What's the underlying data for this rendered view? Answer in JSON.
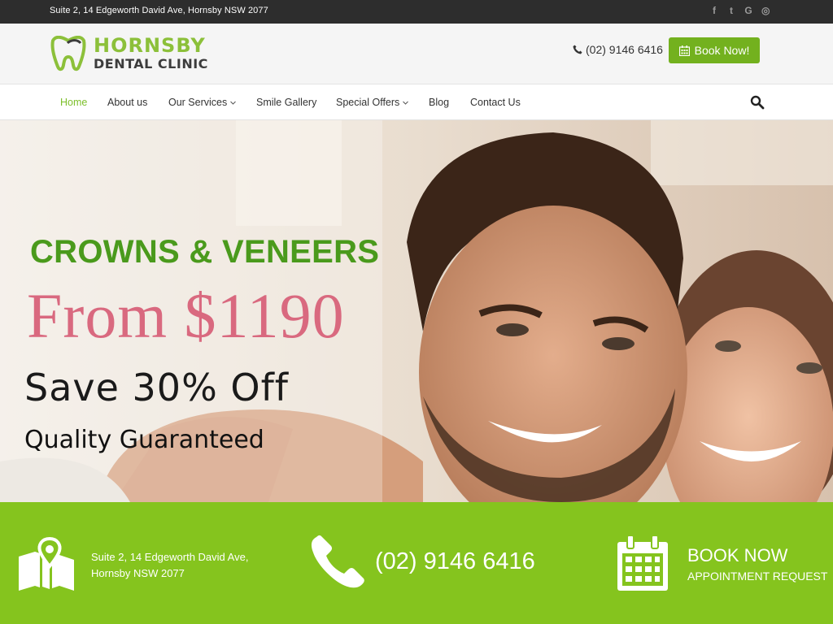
{
  "topbar": {
    "address": "Suite 2, 14 Edgeworth David Ave, Hornsby NSW 2077",
    "social": [
      {
        "icon": "facebook-icon",
        "glyph": "f"
      },
      {
        "icon": "twitter-icon",
        "glyph": "t"
      },
      {
        "icon": "google-icon",
        "glyph": "G"
      },
      {
        "icon": "instagram-icon",
        "glyph": "◎"
      }
    ]
  },
  "header": {
    "logo_line1": "HORNSBY",
    "logo_line2": "DENTAL CLINIC",
    "phone": "(02) 9146 6416",
    "book_label": "Book Now!"
  },
  "nav": {
    "items": [
      {
        "label": "Home",
        "active": true,
        "dropdown": false
      },
      {
        "label": "About us",
        "active": false,
        "dropdown": false
      },
      {
        "label": "Our Services",
        "active": false,
        "dropdown": true
      },
      {
        "label": "Smile Gallery",
        "active": false,
        "dropdown": false
      },
      {
        "label": "Special Offers",
        "active": false,
        "dropdown": true
      },
      {
        "label": "Blog",
        "active": false,
        "dropdown": false
      },
      {
        "label": "Contact Us",
        "active": false,
        "dropdown": false
      }
    ]
  },
  "hero": {
    "title": "CROWNS & VENEERS",
    "price": "From $1190",
    "save": "Save 30% Off",
    "quality": "Quality Guaranteed"
  },
  "strip": {
    "address_line1": "Suite 2, 14 Edgeworth David Ave,",
    "address_line2": "Hornsby NSW 2077",
    "phone": "(02) 9146 6416",
    "book_title": "BOOK NOW",
    "book_sub": "APPOINTMENT REQUEST"
  },
  "colors": {
    "brand_green": "#85c41e",
    "button_green": "#73b11e",
    "title_green": "#4a9a1c",
    "price_pink": "#d9697f",
    "topbar_dark": "#2d2d2d"
  }
}
